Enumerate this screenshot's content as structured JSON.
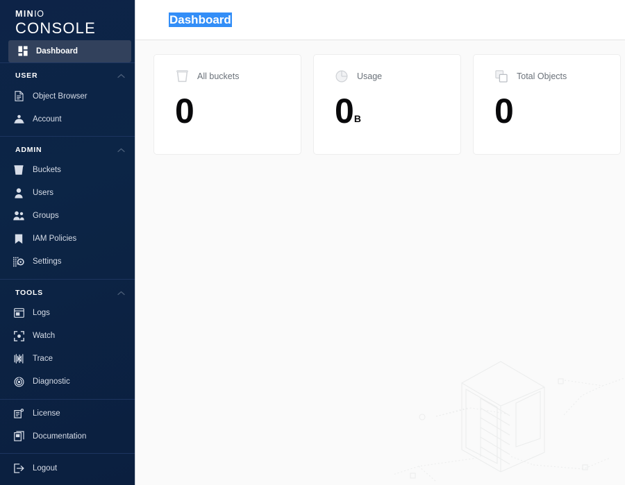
{
  "sidebar": {
    "logo": {
      "brand_prefix": "MIN",
      "brand_suffix": "IO",
      "product": "CONSOLE"
    },
    "primary": [
      {
        "label": "Dashboard",
        "icon": "dashboard-icon",
        "active": true
      }
    ],
    "sections": [
      {
        "title": "USER",
        "key": "user",
        "items": [
          {
            "label": "Object Browser",
            "icon": "document-icon"
          },
          {
            "label": "Account",
            "icon": "account-icon"
          }
        ]
      },
      {
        "title": "ADMIN",
        "key": "admin",
        "items": [
          {
            "label": "Buckets",
            "icon": "bucket-icon"
          },
          {
            "label": "Users",
            "icon": "user-icon"
          },
          {
            "label": "Groups",
            "icon": "groups-icon"
          },
          {
            "label": "IAM Policies",
            "icon": "bookmark-icon"
          },
          {
            "label": "Settings",
            "icon": "settings-icon"
          }
        ]
      },
      {
        "title": "TOOLS",
        "key": "tools",
        "items": [
          {
            "label": "Logs",
            "icon": "logs-icon"
          },
          {
            "label": "Watch",
            "icon": "watch-icon"
          },
          {
            "label": "Trace",
            "icon": "trace-icon"
          },
          {
            "label": "Diagnostic",
            "icon": "diagnostic-icon"
          }
        ]
      }
    ],
    "footer_links": [
      {
        "label": "License",
        "icon": "license-icon"
      },
      {
        "label": "Documentation",
        "icon": "documentation-icon"
      }
    ],
    "logout": {
      "label": "Logout",
      "icon": "logout-icon"
    }
  },
  "header": {
    "title": "Dashboard",
    "title_selected": true,
    "selection_color": "#338ef7"
  },
  "cards": [
    {
      "label": "All buckets",
      "icon": "bucket-icon",
      "value": "0",
      "unit": ""
    },
    {
      "label": "Usage",
      "icon": "pie-chart-icon",
      "value": "0",
      "unit": "B"
    },
    {
      "label": "Total Objects",
      "icon": "objects-icon",
      "value": "0",
      "unit": ""
    }
  ],
  "colors": {
    "sidebar_top": "#0d2347",
    "sidebar_bottom": "#0b1f3f",
    "active_item": "#32415c",
    "accent": "#338ef7",
    "content_bg": "#fafafa",
    "card_bg": "#ffffff"
  },
  "illustration": {
    "name": "isometric-server-rack"
  }
}
